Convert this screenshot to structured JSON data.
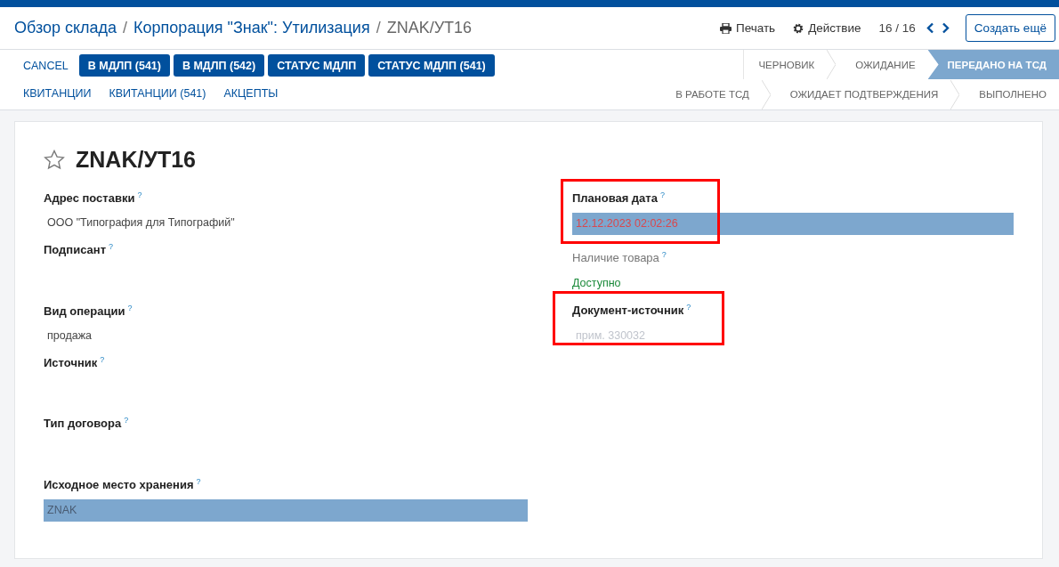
{
  "breadcrumb_separator": "/",
  "breadcrumb": [
    {
      "label": "Обзор склада",
      "current": false
    },
    {
      "label": "Корпорация \"Знак\": Утилизация",
      "current": false
    },
    {
      "label": "ZNAK/УТ16",
      "current": true
    }
  ],
  "toolbar": {
    "print": "Печать",
    "action": "Действие",
    "pager": "16 / 16",
    "create": "Создать ещё"
  },
  "buttons": [
    {
      "label": "CANCEL",
      "kind": "link"
    },
    {
      "label": "В МДЛП (541)",
      "kind": "primary"
    },
    {
      "label": "В МДЛП (542)",
      "kind": "primary"
    },
    {
      "label": "СТАТУС МДЛП",
      "kind": "primary"
    },
    {
      "label": "СТАТУС МДЛП (541)",
      "kind": "primary"
    },
    {
      "label": "КВИТАНЦИИ",
      "kind": "link"
    },
    {
      "label": "КВИТАНЦИИ (541)",
      "kind": "link"
    },
    {
      "label": "АКЦЕПТЫ",
      "kind": "link"
    }
  ],
  "stages": [
    [
      {
        "label": "ЧЕРНОВИК",
        "selected": false
      },
      {
        "label": "ОЖИДАНИЕ",
        "selected": false
      },
      {
        "label": "ПЕРЕДАНО НА ТСД",
        "selected": true
      }
    ],
    [
      {
        "label": "В РАБОТЕ ТСД",
        "selected": false
      },
      {
        "label": "ОЖИДАЕТ ПОДТВЕРЖДЕНИЯ",
        "selected": false
      },
      {
        "label": "ВЫПОЛНЕНО",
        "selected": false
      }
    ]
  ],
  "record": {
    "title": "ZNAK/УТ16",
    "starred": false,
    "help": "?",
    "left": [
      {
        "label": "Адрес поставки",
        "kind": "text",
        "value": "ООО \"Типография для Типографий\""
      },
      {
        "label": "Подписант",
        "kind": "text"
      },
      {
        "label": "Вид операции",
        "kind": "text",
        "value": "продажа"
      },
      {
        "label": "Источник",
        "kind": "text"
      },
      {
        "label": "Тип договора",
        "kind": "text"
      },
      {
        "label": "Исходное место хранения",
        "kind": "selected",
        "value": "ZNAK"
      }
    ],
    "right": [
      {
        "label": "Плановая дата",
        "kind": "date",
        "value": "12.12.2023 02:02:26",
        "highlighted": true
      },
      {
        "label": "Наличие товара",
        "kind": "status",
        "value": "Доступно"
      },
      {
        "label": "Документ-источник",
        "kind": "input",
        "placeholder": "прим. 330032",
        "highlighted": true
      }
    ]
  }
}
